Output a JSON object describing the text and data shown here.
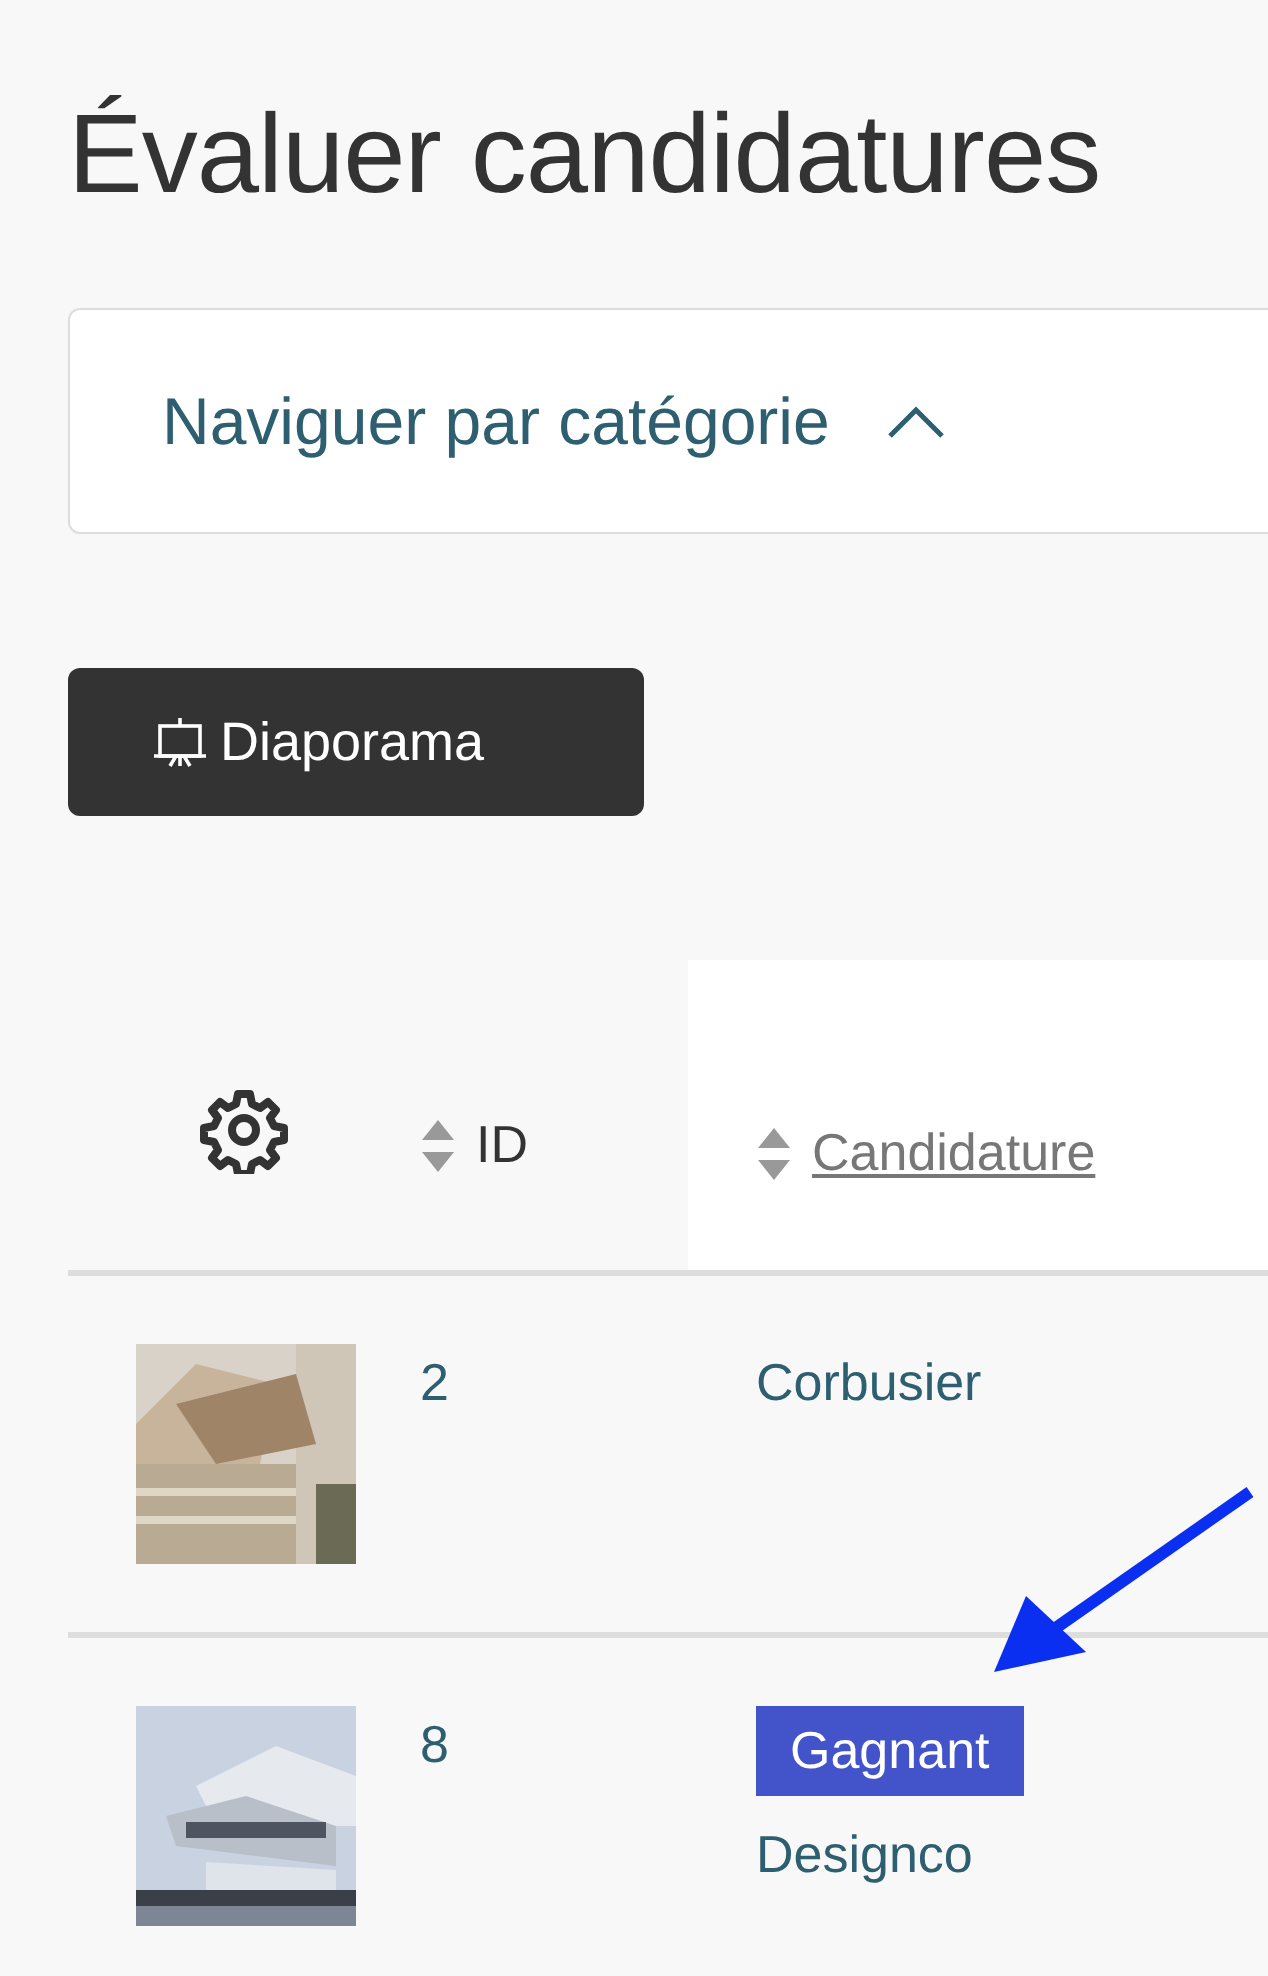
{
  "title": "Évaluer candidatures",
  "category_nav": {
    "label": "Naviguer par catégorie",
    "expanded": true
  },
  "slideshow_button": {
    "label": "Diaporama"
  },
  "table": {
    "columns": [
      {
        "label": "ID",
        "sortable": true,
        "selected": false
      },
      {
        "label": "Candidature",
        "sortable": true,
        "selected": true
      }
    ],
    "rows": [
      {
        "id": "2",
        "name": "Corbusier"
      },
      {
        "id": "8",
        "badge": "Gagnant",
        "name": "Designco"
      }
    ]
  }
}
